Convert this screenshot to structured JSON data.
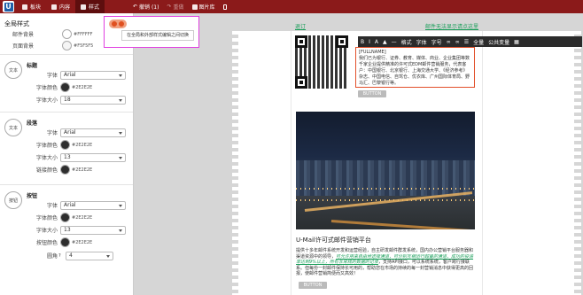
{
  "topbar": {
    "tabs": [
      {
        "label": "板块",
        "icon": "blocks-icon"
      },
      {
        "label": "内容",
        "icon": "content-icon"
      },
      {
        "label": "样式",
        "icon": "style-icon",
        "active": true
      }
    ],
    "toolbar": {
      "undo": "撤销 (1)",
      "redo": "重做",
      "library": "图片库",
      "mobile": "mobile-icon"
    }
  },
  "sidebar": {
    "title": "全局样式",
    "global": {
      "email_bg_label": "邮件背景",
      "email_bg_value": "#FFFFFF",
      "page_bg_label": "页面背景",
      "page_bg_value": "#F5F5F5"
    },
    "heading": {
      "icon_text": "文本",
      "title": "标题",
      "font_label": "字体",
      "font_value": "Arial",
      "color_label": "字体颜色",
      "color_value": "#2E2E2E",
      "size_label": "字体大小",
      "size_value": "18"
    },
    "paragraph": {
      "icon_text": "文本",
      "title": "段落",
      "font_label": "字体",
      "font_value": "Arial",
      "color_label": "字体颜色",
      "color_value": "#2E2E2E",
      "size_label": "字体大小",
      "size_value": "13",
      "link_label": "链接颜色",
      "link_value": "#2E2E2E"
    },
    "button": {
      "icon_text": "按钮",
      "title": "按钮",
      "font_label": "字体",
      "font_value": "Arial",
      "color_label": "字体颜色",
      "color_value": "#2E2E2E",
      "size_label": "字体大小",
      "size_value": "13",
      "btn_color_label": "按钮颜色",
      "btn_color_value": "#2E2E2E",
      "radius_label": "圆角",
      "radius_value": "4"
    }
  },
  "tooltip": {
    "text": "在全局和外部样式编辑之间切换"
  },
  "editor": {
    "links": [
      "退订",
      "邮件无法显示请点这里"
    ],
    "rte_items": [
      "B",
      "I",
      "A",
      "▲",
      "—",
      "格式",
      "字体",
      "字号",
      "∞",
      "∞",
      "☰",
      "全量",
      "公共变量",
      "▦"
    ],
    "text_fullname": "[FULLNAME]",
    "text_body": "我们已为银行、证券、教育、媒体、商业、企业集团等数千家企业提供精准的许可式EDM邮件营销服务，代表客户：中国银行、北京银行、上海交通大学、《经济参考》杂志、中国电信、自驾仓、优衣库、广州国际体育局、野马汇、巴黎银行等。",
    "button1": "BUTTON",
    "headline": "U-Mail许可式邮件营销平台",
    "para_start": "提供十多年邮件系统开发和运营经验，自主研发邮件群发系统，国内办公营销平台服务器和渠道资源中的领导，",
    "para_highlight": "可允许用来自由地选择通道，可分别互相运行超量的通道，成功的投递率达到9%以上，所有非常规的数据的记录",
    "para_end": "，支持API接口，可以系统系统，客户跨行接联系。但每份一封邮件保持长可用的，帮助您在市场的持续的每一封营销消息中获得更高的回报，使邮件营销简便而又高效！",
    "button2": "BUTTON"
  },
  "colors": {
    "brand": "#8B1A1A",
    "accent": "#1A9E5A",
    "highlight_border": "#E2502A",
    "tooltip_border": "#E040E0"
  }
}
